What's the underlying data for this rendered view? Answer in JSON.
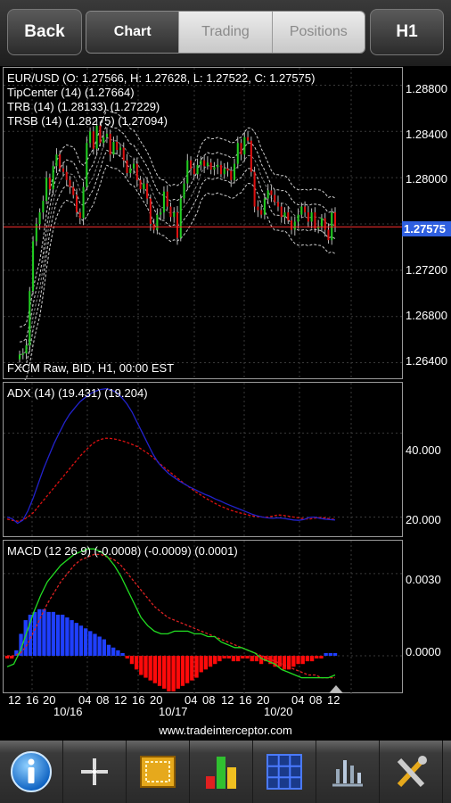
{
  "topbar": {
    "back_label": "Back",
    "tabs": [
      "Chart",
      "Trading",
      "Positions"
    ],
    "timeframe": "H1"
  },
  "price_pane": {
    "info": [
      "EUR/USD (O: 1.27566, H: 1.27628, L: 1.27522, C: 1.27575)",
      "TipCenter (14) (1.27664)",
      "TRB (14) (1.28133) (1.27229)",
      "TRSB (14) (1.28275) (1.27094)"
    ],
    "footer": "FXCM Raw, BID, H1, 00:00 EST",
    "y_labels": [
      "1.28800",
      "1.28400",
      "1.28000",
      "1.27600",
      "1.27200",
      "1.26800",
      "1.26400"
    ],
    "current_price": "1.27575"
  },
  "adx_pane": {
    "title": "ADX (14) (19.431) (19.204)",
    "y_labels": [
      "40.000",
      "20.000"
    ]
  },
  "macd_pane": {
    "title": "MACD (12 26 9) (-0.0008) (-0.0009) (0.0001)",
    "y_labels": [
      "0.0030",
      "0.0000"
    ]
  },
  "x_axis": {
    "hour_labels": [
      "12",
      "16",
      "20",
      "04",
      "08",
      "12",
      "16",
      "20",
      "04",
      "08",
      "12",
      "16",
      "20",
      "04",
      "08",
      "12"
    ],
    "date_labels": [
      "10/16",
      "10/17",
      "10/20"
    ]
  },
  "footer_url": "www.tradeinterceptor.com",
  "toolbar": [
    "info-icon",
    "crosshair-icon",
    "zoom-icon",
    "indicators-icon",
    "grid-icon",
    "chart-type-icon",
    "settings-icon"
  ],
  "colors": {
    "bull": "#22cc22",
    "bear": "#dd1111",
    "adx": "#2222cc",
    "macd_signal": "#dd2222",
    "macd_line": "#22dd22",
    "hist_up": "#1f3fff",
    "hist_down": "#ff0a0a",
    "price_tag": "#2f5fe0"
  },
  "chart_data": [
    {
      "type": "candlestick",
      "title": "EUR/USD",
      "ylim": [
        1.2625,
        1.2895
      ],
      "y_ticks": [
        1.288,
        1.284,
        1.28,
        1.276,
        1.272,
        1.268,
        1.264
      ],
      "close_series": [
        1.2647,
        1.2648,
        1.2655,
        1.2702,
        1.2745,
        1.276,
        1.277,
        1.278,
        1.28,
        1.279,
        1.281,
        1.282,
        1.2808,
        1.2805,
        1.2798,
        1.2792,
        1.2785,
        1.277,
        1.2765,
        1.2792,
        1.283,
        1.284,
        1.2825,
        1.2845,
        1.283,
        1.2835,
        1.2838,
        1.282,
        1.2831,
        1.2824,
        1.2826,
        1.2815,
        1.2804,
        1.2808,
        1.2812,
        1.2798,
        1.279,
        1.2795,
        1.2782,
        1.276,
        1.2755,
        1.2768,
        1.277,
        1.2788,
        1.2775,
        1.2766,
        1.277,
        1.2748,
        1.2782,
        1.2795,
        1.2815,
        1.2808,
        1.2803,
        1.2811,
        1.2815,
        1.281,
        1.2813,
        1.2807,
        1.2809,
        1.2811,
        1.2803,
        1.2808,
        1.2806,
        1.2798,
        1.2812,
        1.283,
        1.282,
        1.2835,
        1.2832,
        1.2805,
        1.2775,
        1.2772,
        1.2768,
        1.2782,
        1.2789,
        1.2785,
        1.2779,
        1.2775,
        1.2766,
        1.277,
        1.2763,
        1.2755,
        1.2762,
        1.2768,
        1.2775,
        1.277,
        1.2762,
        1.277,
        1.2756,
        1.2758,
        1.2765,
        1.2755,
        1.2746,
        1.277,
        1.2758
      ]
    },
    {
      "type": "line",
      "title": "ADX (14)",
      "ylim": [
        15,
        52
      ],
      "y_ticks": [
        40,
        20
      ],
      "series": [
        {
          "name": "ADX",
          "values": [
            20,
            19.6,
            18.5,
            19.2,
            21.5,
            24.5,
            28,
            31.5,
            34.5,
            37.5,
            40,
            42.5,
            44.5,
            46,
            47.5,
            48.5,
            49.4,
            50,
            50.4,
            50.6,
            50.3,
            49.7,
            48.5,
            47,
            45,
            42.5,
            40,
            37.5,
            35,
            33,
            31.6,
            30.4,
            29.5,
            28.6,
            27.9,
            27.2,
            26.6,
            26,
            25.4,
            24.9,
            24.3,
            23.8,
            23.2,
            22.7,
            22.2,
            21.7,
            21.2,
            20.7,
            20.3,
            20,
            19.8,
            19.7,
            19.8,
            19.7,
            19.5,
            19.3,
            19.2,
            19.4,
            19.9,
            20,
            19.7,
            19.5,
            19.4,
            19.3
          ]
        },
        {
          "name": "DI",
          "values": [
            19.5,
            19.2,
            19,
            19.3,
            20,
            21,
            22.5,
            24,
            25.5,
            27,
            28.5,
            30,
            31.5,
            33,
            34.5,
            35.8,
            37,
            38,
            38.5,
            38.8,
            38.7,
            38.5,
            38.2,
            37.8,
            37.3,
            36.8,
            36,
            35.2,
            34.2,
            33.1,
            32,
            31,
            30,
            29,
            28,
            27.1,
            26.2,
            25.4,
            24.6,
            23.9,
            23.2,
            22.6,
            22.1,
            21.6,
            21.2,
            20.9,
            20.6,
            20.3,
            20.1,
            20,
            20,
            20.2,
            20.5,
            20.4,
            20.2,
            20,
            19.8,
            19.6,
            19.5,
            19.7,
            19.9,
            19.8,
            19.6,
            19.4
          ]
        }
      ]
    },
    {
      "type": "line",
      "title": "MACD (12 26 9)",
      "ylim": [
        -0.0014,
        0.0042
      ],
      "y_ticks": [
        0.003,
        0.0
      ],
      "series": [
        {
          "name": "MACD",
          "values": [
            -0.0004,
            -0.0003,
            0.0002,
            0.0009,
            0.0016,
            0.0022,
            0.0027,
            0.003,
            0.0033,
            0.0035,
            0.0037,
            0.0038,
            0.0039,
            0.0039,
            0.0038,
            0.0036,
            0.0033,
            0.0029,
            0.0024,
            0.0019,
            0.0014,
            0.0011,
            0.0009,
            0.0008,
            0.0008,
            0.0009,
            0.0009,
            0.0009,
            0.0008,
            0.0008,
            0.0007,
            0.0007,
            0.0005,
            0.0004,
            0.0003,
            0.0003,
            0.0002,
            0.0001,
            -0.0001,
            -0.0002,
            -0.0003,
            -0.0005,
            -0.0006,
            -0.0007,
            -0.0008,
            -0.0008,
            -0.0008,
            -0.0008,
            -0.0008,
            -0.0007
          ]
        },
        {
          "name": "Signal",
          "values": [
            0,
            0,
            0.0001,
            0.0004,
            0.0009,
            0.0014,
            0.0019,
            0.0023,
            0.0027,
            0.003,
            0.0033,
            0.0035,
            0.0036,
            0.0037,
            0.0037,
            0.0036,
            0.0035,
            0.0033,
            0.003,
            0.0027,
            0.0024,
            0.0021,
            0.0018,
            0.0016,
            0.0014,
            0.0013,
            0.0012,
            0.0011,
            0.001,
            0.0009,
            0.0008,
            0.0007,
            0.0006,
            0.0005,
            0.0004,
            0.0003,
            0.0002,
            0.0001,
            0,
            -0.0001,
            -0.0002,
            -0.0003,
            -0.0004,
            -0.0005,
            -0.0006,
            -0.0007,
            -0.0007,
            -0.0008,
            -0.0008,
            -0.0008
          ]
        },
        {
          "name": "Histogram",
          "values": [
            -0.0001,
            -0.0001,
            0.0002,
            0.0008,
            0.0013,
            0.0015,
            0.0016,
            0.0017,
            0.0017,
            0.0016,
            0.0016,
            0.0015,
            0.0015,
            0.0014,
            0.0013,
            0.0012,
            0.0011,
            0.001,
            0.0009,
            0.0008,
            0.0007,
            0.0006,
            0.0004,
            0.0003,
            0.0002,
            0.0001,
            -0.0001,
            -0.0003,
            -0.0005,
            -0.0007,
            -0.0008,
            -0.0009,
            -0.001,
            -0.0011,
            -0.0012,
            -0.0013,
            -0.0013,
            -0.0012,
            -0.0011,
            -0.001,
            -0.0009,
            -0.0008,
            -0.0006,
            -0.0005,
            -0.0004,
            -0.0003,
            -0.0002,
            -0.0001,
            -0.0001,
            -0.0002,
            -0.0002,
            -0.0001,
            -0.0001,
            -0.0002,
            -0.0002,
            -0.0003,
            -0.0002,
            -0.0003,
            -0.0004,
            -0.0004,
            -0.0005,
            -0.0005,
            -0.0004,
            -0.0003,
            -0.0003,
            -0.0002,
            -0.0002,
            -0.0001,
            -0.0001,
            0.0001,
            0.0001,
            0.0001
          ]
        }
      ]
    }
  ]
}
